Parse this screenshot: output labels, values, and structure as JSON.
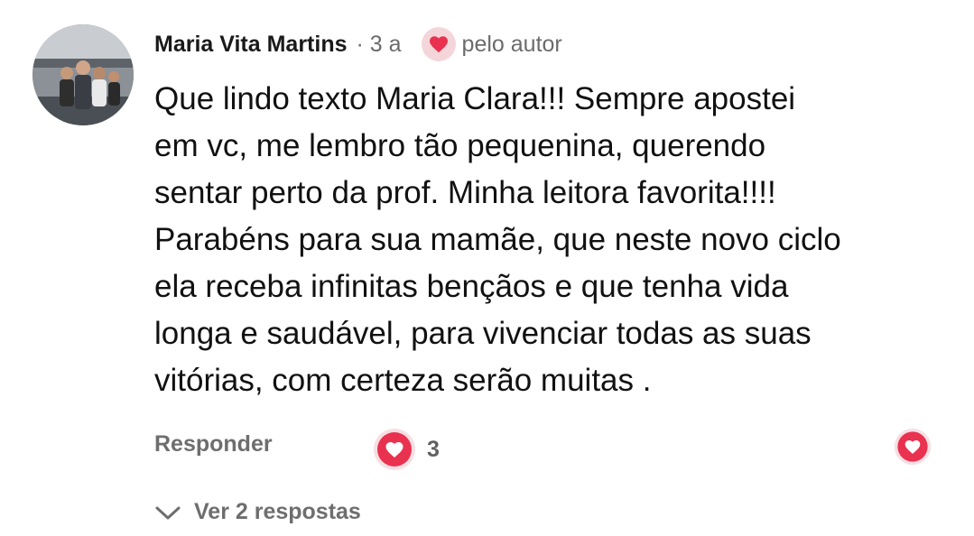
{
  "comment": {
    "author": "Maria Vita Martins",
    "time": "· 3 a",
    "liked_by_author_label": "pelo autor",
    "text": "Que lindo texto Maria Clara!!! Sempre apostei\nem vc, me lembro tão pequenina, querendo\nsentar perto da prof. Minha leitora favorita!!!!\nParabéns para sua mamãe, que neste novo ciclo\nela receba infinitas bençãos e que tenha vida\nlonga e saudável, para vivenciar todas as suas\nvitórias, com certeza serão muitas ."
  },
  "actions": {
    "reply_label": "Responder",
    "like_count": "3",
    "view_replies_label": "Ver 2 respostas"
  },
  "colors": {
    "heart": "#e8324f",
    "heart_badge_bg": "#f4d6da",
    "muted_text": "#6e6e6e"
  },
  "icons": {
    "heart": "heart-icon",
    "chevron": "chevron-down-icon"
  }
}
